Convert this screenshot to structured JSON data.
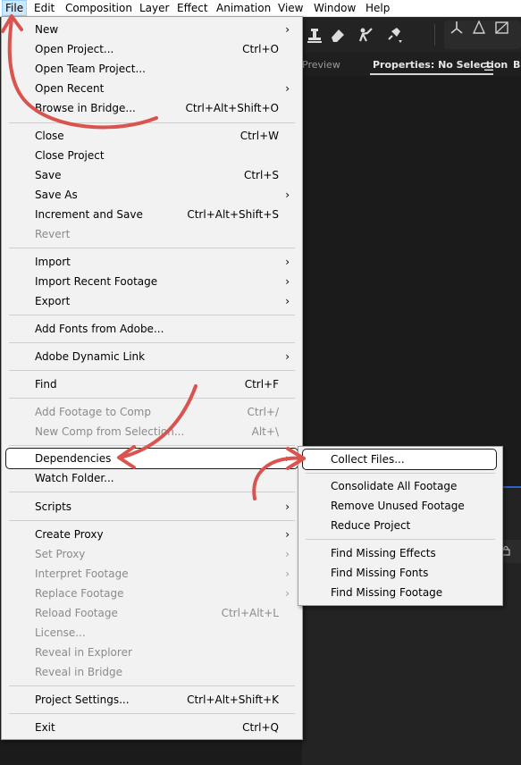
{
  "menubar": {
    "items": [
      "File",
      "Edit",
      "Composition",
      "Layer",
      "Effect",
      "Animation",
      "View",
      "Window",
      "Help"
    ]
  },
  "toolbar": {
    "icons": [
      "stamp-tool-icon",
      "eraser-tool-icon",
      "roto-brush-icon",
      "puppet-pin-icon",
      "axis-local-icon",
      "axis-world-icon",
      "axis-view-icon"
    ]
  },
  "panels": {
    "preview_tab": "Preview",
    "properties_tab": "Properties: No Selection",
    "next_tab": "Br"
  },
  "file_menu": {
    "new": {
      "label": "New"
    },
    "open_project": {
      "label": "Open Project...",
      "shortcut": "Ctrl+O"
    },
    "open_team_project": {
      "label": "Open Team Project..."
    },
    "open_recent": {
      "label": "Open Recent"
    },
    "browse_in_bridge": {
      "label": "Browse in Bridge...",
      "shortcut": "Ctrl+Alt+Shift+O"
    },
    "close": {
      "label": "Close",
      "shortcut": "Ctrl+W"
    },
    "close_project": {
      "label": "Close Project"
    },
    "save": {
      "label": "Save",
      "shortcut": "Ctrl+S"
    },
    "save_as": {
      "label": "Save As"
    },
    "increment_and_save": {
      "label": "Increment and Save",
      "shortcut": "Ctrl+Alt+Shift+S"
    },
    "revert": {
      "label": "Revert"
    },
    "import": {
      "label": "Import"
    },
    "import_recent_footage": {
      "label": "Import Recent Footage"
    },
    "export": {
      "label": "Export"
    },
    "add_fonts": {
      "label": "Add Fonts from Adobe..."
    },
    "dynamic_link": {
      "label": "Adobe Dynamic Link"
    },
    "find": {
      "label": "Find",
      "shortcut": "Ctrl+F"
    },
    "add_footage_to_comp": {
      "label": "Add Footage to Comp",
      "shortcut": "Ctrl+/"
    },
    "new_comp_from_selection": {
      "label": "New Comp from Selection...",
      "shortcut": "Alt+\\"
    },
    "dependencies": {
      "label": "Dependencies"
    },
    "watch_folder": {
      "label": "Watch Folder..."
    },
    "scripts": {
      "label": "Scripts"
    },
    "create_proxy": {
      "label": "Create Proxy"
    },
    "set_proxy": {
      "label": "Set Proxy"
    },
    "interpret_footage": {
      "label": "Interpret Footage"
    },
    "replace_footage": {
      "label": "Replace Footage"
    },
    "reload_footage": {
      "label": "Reload Footage",
      "shortcut": "Ctrl+Alt+L"
    },
    "license": {
      "label": "License..."
    },
    "reveal_in_explorer": {
      "label": "Reveal in Explorer"
    },
    "reveal_in_bridge": {
      "label": "Reveal in Bridge"
    },
    "project_settings": {
      "label": "Project Settings...",
      "shortcut": "Ctrl+Alt+Shift+K"
    },
    "exit": {
      "label": "Exit",
      "shortcut": "Ctrl+Q"
    }
  },
  "dependencies_menu": {
    "collect_files": {
      "label": "Collect Files..."
    },
    "consolidate_all_footage": {
      "label": "Consolidate All Footage"
    },
    "remove_unused_footage": {
      "label": "Remove Unused Footage"
    },
    "reduce_project": {
      "label": "Reduce Project"
    },
    "find_missing_effects": {
      "label": "Find Missing Effects"
    },
    "find_missing_fonts": {
      "label": "Find Missing Fonts"
    },
    "find_missing_footage": {
      "label": "Find Missing Footage"
    }
  },
  "colors": {
    "menu_bg": "#f2f2f2",
    "highlight_border": "#1a1a1a",
    "annotation_arrow": "#d9534f",
    "menubar_active": "#cce8ff",
    "panel_focus": "#2d63c8"
  }
}
